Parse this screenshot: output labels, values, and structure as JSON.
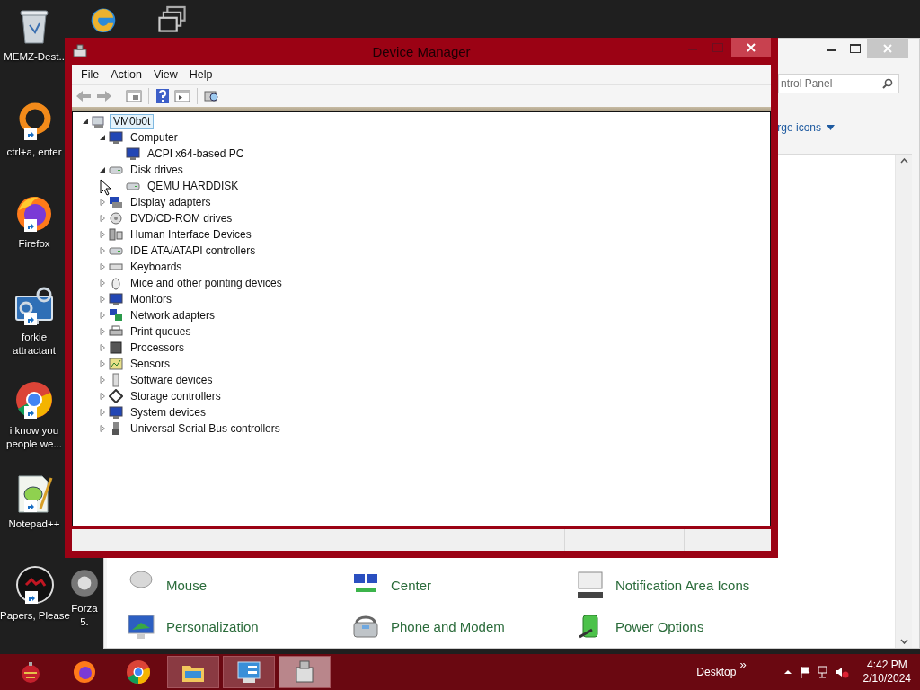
{
  "desktop": {
    "icons": [
      {
        "kind": "recycle-bin",
        "label": "MEMZ-Dest..",
        "shortcut": false
      },
      {
        "kind": "edge",
        "shortcut": false
      },
      {
        "kind": "windows",
        "shortcut": false
      },
      {
        "kind": "ring",
        "label": "ctrl+a, enter",
        "shortcut": true
      },
      {
        "kind": "firefox",
        "label": "Firefox",
        "shortcut": true
      },
      {
        "kind": "gear-monitor",
        "label": "forkie attractant",
        "shortcut": true
      },
      {
        "kind": "chrome",
        "label": "i know you people we...",
        "shortcut": true
      },
      {
        "kind": "notepad",
        "label": "Notepad++",
        "shortcut": true
      },
      {
        "kind": "disc",
        "label": "Papers, Please",
        "shortcut": true
      },
      {
        "kind": "sphere",
        "label": "Forza 5.",
        "shortcut": false
      }
    ]
  },
  "control_panel": {
    "search": {
      "placeholder": "ntrol Panel"
    },
    "view_by": "rge icons",
    "items": [
      {
        "label": "Mouse",
        "kind": "mouse"
      },
      {
        "label": "Center",
        "kind": "network"
      },
      {
        "label": "Notification Area Icons",
        "kind": "notification"
      },
      {
        "label": "Personalization",
        "kind": "personalization"
      },
      {
        "label": "Phone and Modem",
        "kind": "phone"
      },
      {
        "label": "Power Options",
        "kind": "power"
      }
    ]
  },
  "device_manager": {
    "title": "Device Manager",
    "menu": [
      "File",
      "Action",
      "View",
      "Help"
    ],
    "tree": [
      {
        "label": "VM0b0t",
        "kind": "computer",
        "selected": true,
        "expanded": true,
        "children": [
          {
            "label": "Computer",
            "kind": "monitor",
            "selected": false,
            "expanded": true,
            "children": [
              {
                "label": "ACPI x64-based PC",
                "kind": "monitor",
                "selected": false
              }
            ]
          },
          {
            "label": "Disk drives",
            "kind": "disk",
            "selected": false,
            "expanded": true,
            "children": [
              {
                "label": "QEMU HARDDISK",
                "kind": "disk",
                "selected": false
              }
            ]
          },
          {
            "label": "Display adapters",
            "kind": "display",
            "selected": false,
            "expanded": false
          },
          {
            "label": "DVD/CD-ROM drives",
            "kind": "dvd",
            "selected": false,
            "expanded": false
          },
          {
            "label": "Human Interface Devices",
            "kind": "hid",
            "selected": false,
            "expanded": false
          },
          {
            "label": "IDE ATA/ATAPI controllers",
            "kind": "disk",
            "selected": false,
            "expanded": false
          },
          {
            "label": "Keyboards",
            "kind": "keyboard",
            "selected": false,
            "expanded": false
          },
          {
            "label": "Mice and other pointing devices",
            "kind": "mouse",
            "selected": false,
            "expanded": false
          },
          {
            "label": "Monitors",
            "kind": "monitor",
            "selected": false,
            "expanded": false
          },
          {
            "label": "Network adapters",
            "kind": "network",
            "selected": false,
            "expanded": false
          },
          {
            "label": "Print queues",
            "kind": "printer",
            "selected": false,
            "expanded": false
          },
          {
            "label": "Processors",
            "kind": "processor",
            "selected": false,
            "expanded": false
          },
          {
            "label": "Sensors",
            "kind": "sensor",
            "selected": false,
            "expanded": false
          },
          {
            "label": "Software devices",
            "kind": "software",
            "selected": false,
            "expanded": false
          },
          {
            "label": "Storage controllers",
            "kind": "storage",
            "selected": false,
            "expanded": false
          },
          {
            "label": "System devices",
            "kind": "monitor",
            "selected": false,
            "expanded": false
          },
          {
            "label": "Universal Serial Bus controllers",
            "kind": "usb",
            "selected": false,
            "expanded": false
          }
        ]
      }
    ]
  },
  "taskbar": {
    "apps": [
      {
        "kind": "ornament",
        "open": false,
        "active": false
      },
      {
        "kind": "firefox",
        "open": false,
        "active": false
      },
      {
        "kind": "chrome",
        "open": false,
        "active": false
      },
      {
        "kind": "explorer",
        "open": true,
        "active": false
      },
      {
        "kind": "control-panel",
        "open": true,
        "active": false
      },
      {
        "kind": "device-manager",
        "open": true,
        "active": true
      }
    ],
    "toolbar": "Desktop",
    "chevron": "»",
    "time": "4:42 PM",
    "date": "2/10/2024"
  }
}
